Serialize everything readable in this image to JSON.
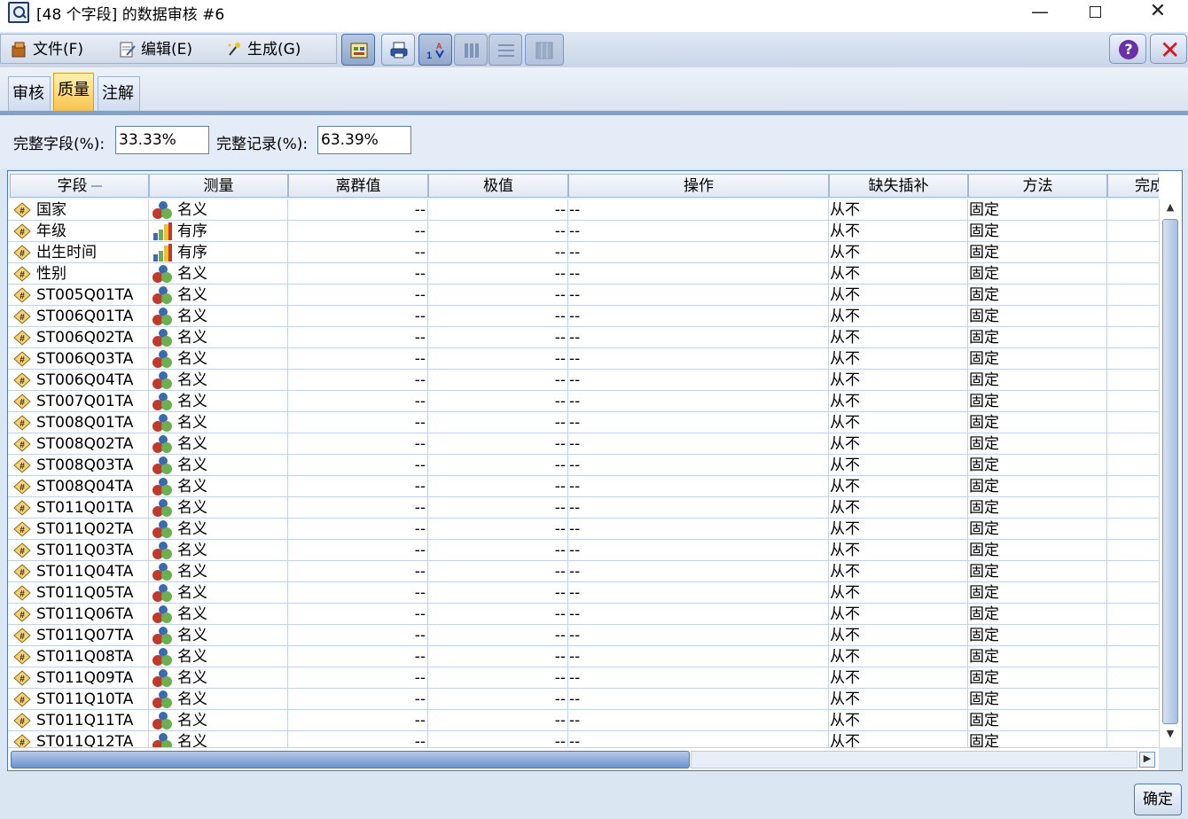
{
  "window": {
    "title": "[48 个字段] 的数据审核 #6",
    "minimize": "—",
    "close": "✕"
  },
  "menu": {
    "file": "文件(F)",
    "edit": "编辑(E)",
    "generate": "生成(G)"
  },
  "tabs": [
    "审核",
    "质量",
    "注解"
  ],
  "active_tab": "质量",
  "stats": {
    "complete_fields_label": "完整字段(%):",
    "complete_fields_value": "33.33%",
    "complete_records_label": "完整记录(%):",
    "complete_records_value": "63.39%"
  },
  "table": {
    "columns": [
      "字段",
      "测量",
      "离群值",
      "极值",
      "操作",
      "缺失插补",
      "方法",
      "完成"
    ],
    "rows": [
      {
        "field": "国家",
        "measure": "名义",
        "mtype": "nominal",
        "outliers": "--",
        "extremes": "--",
        "action": "--",
        "impute": "从不",
        "method": "固定"
      },
      {
        "field": "年级",
        "measure": "有序",
        "mtype": "ordinal",
        "outliers": "--",
        "extremes": "--",
        "action": "--",
        "impute": "从不",
        "method": "固定"
      },
      {
        "field": "出生时间",
        "measure": "有序",
        "mtype": "ordinal",
        "outliers": "--",
        "extremes": "--",
        "action": "--",
        "impute": "从不",
        "method": "固定"
      },
      {
        "field": "性别",
        "measure": "名义",
        "mtype": "nominal",
        "outliers": "--",
        "extremes": "--",
        "action": "--",
        "impute": "从不",
        "method": "固定"
      },
      {
        "field": "ST005Q01TA",
        "measure": "名义",
        "mtype": "nominal",
        "outliers": "--",
        "extremes": "--",
        "action": "--",
        "impute": "从不",
        "method": "固定"
      },
      {
        "field": "ST006Q01TA",
        "measure": "名义",
        "mtype": "nominal",
        "outliers": "--",
        "extremes": "--",
        "action": "--",
        "impute": "从不",
        "method": "固定"
      },
      {
        "field": "ST006Q02TA",
        "measure": "名义",
        "mtype": "nominal",
        "outliers": "--",
        "extremes": "--",
        "action": "--",
        "impute": "从不",
        "method": "固定"
      },
      {
        "field": "ST006Q03TA",
        "measure": "名义",
        "mtype": "nominal",
        "outliers": "--",
        "extremes": "--",
        "action": "--",
        "impute": "从不",
        "method": "固定"
      },
      {
        "field": "ST006Q04TA",
        "measure": "名义",
        "mtype": "nominal",
        "outliers": "--",
        "extremes": "--",
        "action": "--",
        "impute": "从不",
        "method": "固定"
      },
      {
        "field": "ST007Q01TA",
        "measure": "名义",
        "mtype": "nominal",
        "outliers": "--",
        "extremes": "--",
        "action": "--",
        "impute": "从不",
        "method": "固定"
      },
      {
        "field": "ST008Q01TA",
        "measure": "名义",
        "mtype": "nominal",
        "outliers": "--",
        "extremes": "--",
        "action": "--",
        "impute": "从不",
        "method": "固定"
      },
      {
        "field": "ST008Q02TA",
        "measure": "名义",
        "mtype": "nominal",
        "outliers": "--",
        "extremes": "--",
        "action": "--",
        "impute": "从不",
        "method": "固定"
      },
      {
        "field": "ST008Q03TA",
        "measure": "名义",
        "mtype": "nominal",
        "outliers": "--",
        "extremes": "--",
        "action": "--",
        "impute": "从不",
        "method": "固定"
      },
      {
        "field": "ST008Q04TA",
        "measure": "名义",
        "mtype": "nominal",
        "outliers": "--",
        "extremes": "--",
        "action": "--",
        "impute": "从不",
        "method": "固定"
      },
      {
        "field": "ST011Q01TA",
        "measure": "名义",
        "mtype": "nominal",
        "outliers": "--",
        "extremes": "--",
        "action": "--",
        "impute": "从不",
        "method": "固定"
      },
      {
        "field": "ST011Q02TA",
        "measure": "名义",
        "mtype": "nominal",
        "outliers": "--",
        "extremes": "--",
        "action": "--",
        "impute": "从不",
        "method": "固定"
      },
      {
        "field": "ST011Q03TA",
        "measure": "名义",
        "mtype": "nominal",
        "outliers": "--",
        "extremes": "--",
        "action": "--",
        "impute": "从不",
        "method": "固定"
      },
      {
        "field": "ST011Q04TA",
        "measure": "名义",
        "mtype": "nominal",
        "outliers": "--",
        "extremes": "--",
        "action": "--",
        "impute": "从不",
        "method": "固定"
      },
      {
        "field": "ST011Q05TA",
        "measure": "名义",
        "mtype": "nominal",
        "outliers": "--",
        "extremes": "--",
        "action": "--",
        "impute": "从不",
        "method": "固定"
      },
      {
        "field": "ST011Q06TA",
        "measure": "名义",
        "mtype": "nominal",
        "outliers": "--",
        "extremes": "--",
        "action": "--",
        "impute": "从不",
        "method": "固定"
      },
      {
        "field": "ST011Q07TA",
        "measure": "名义",
        "mtype": "nominal",
        "outliers": "--",
        "extremes": "--",
        "action": "--",
        "impute": "从不",
        "method": "固定"
      },
      {
        "field": "ST011Q08TA",
        "measure": "名义",
        "mtype": "nominal",
        "outliers": "--",
        "extremes": "--",
        "action": "--",
        "impute": "从不",
        "method": "固定"
      },
      {
        "field": "ST011Q09TA",
        "measure": "名义",
        "mtype": "nominal",
        "outliers": "--",
        "extremes": "--",
        "action": "--",
        "impute": "从不",
        "method": "固定"
      },
      {
        "field": "ST011Q10TA",
        "measure": "名义",
        "mtype": "nominal",
        "outliers": "--",
        "extremes": "--",
        "action": "--",
        "impute": "从不",
        "method": "固定"
      },
      {
        "field": "ST011Q11TA",
        "measure": "名义",
        "mtype": "nominal",
        "outliers": "--",
        "extremes": "--",
        "action": "--",
        "impute": "从不",
        "method": "固定"
      },
      {
        "field": "ST011Q12TA",
        "measure": "名义",
        "mtype": "nominal",
        "outliers": "--",
        "extremes": "--",
        "action": "--",
        "impute": "从不",
        "method": "固定"
      }
    ]
  },
  "buttons": {
    "ok": "确定"
  },
  "colors": {
    "accent": "#4f77b3",
    "active_tab": "#f8c34c"
  }
}
